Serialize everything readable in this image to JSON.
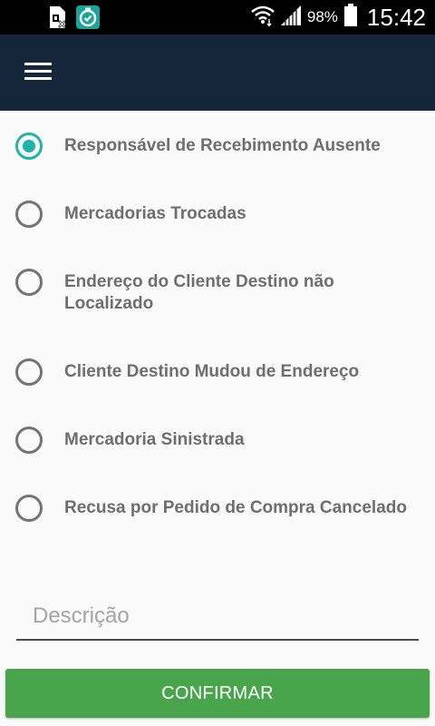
{
  "status_bar": {
    "battery_percent": "98%",
    "time": "15:42",
    "left_icons": [
      "sim-card-blocked-icon",
      "timer-app-icon"
    ],
    "right_icons": [
      "wifi-icon",
      "signal-icon",
      "battery-icon"
    ]
  },
  "app_bar": {
    "menu_icon": "hamburger-menu-icon",
    "background": "#16263a"
  },
  "options": {
    "selected_index": 0,
    "accent_color": "#1fb3ad",
    "items": [
      {
        "label": "Responsável de Recebimento Ausente",
        "checked": true
      },
      {
        "label": "Mercadorias Trocadas",
        "checked": false
      },
      {
        "label": "Endereço do Cliente Destino não Localizado",
        "checked": false
      },
      {
        "label": "Cliente Destino Mudou de Endereço",
        "checked": false
      },
      {
        "label": "Mercadoria Sinistrada",
        "checked": false
      },
      {
        "label": "Recusa por Pedido de Compra Cancelado",
        "checked": false
      }
    ]
  },
  "description": {
    "placeholder": "Descrição",
    "value": ""
  },
  "confirm": {
    "label": "CONFIRMAR",
    "color": "#49a54c"
  }
}
